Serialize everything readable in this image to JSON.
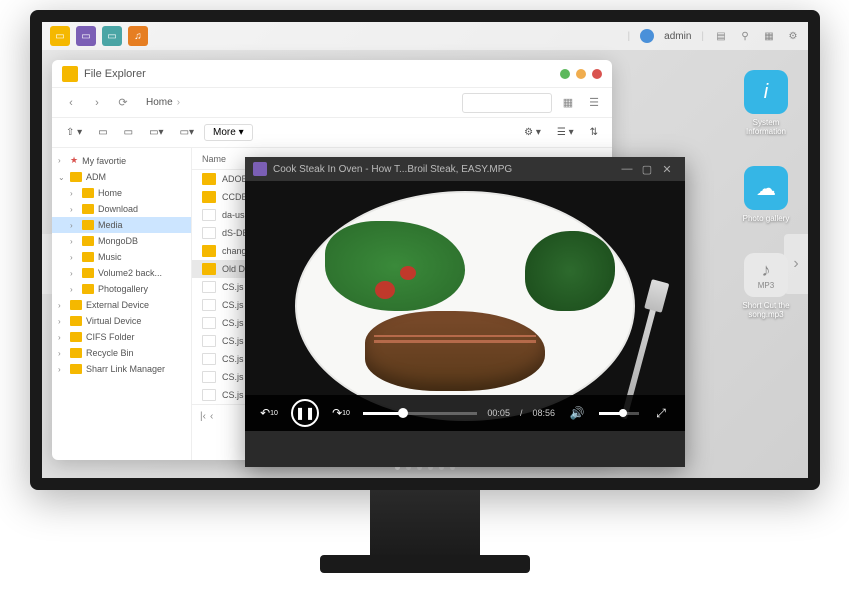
{
  "topbar": {
    "user": "admin"
  },
  "desktop": {
    "icons": [
      {
        "label": "System Information"
      },
      {
        "label": "Photo gallery"
      },
      {
        "label": "MP3",
        "sub": "Short Cut the song.mp3"
      }
    ]
  },
  "explorer": {
    "title": "File Explorer",
    "breadcrumb": "Home",
    "more_label": "More",
    "col_name": "Name",
    "sidebar": [
      {
        "label": "My favortie",
        "type": "fav",
        "expand": "›"
      },
      {
        "label": "ADM",
        "type": "folder",
        "expand": "⌄"
      },
      {
        "label": "Home",
        "type": "sub",
        "expand": "›"
      },
      {
        "label": "Download",
        "type": "sub",
        "expand": "›"
      },
      {
        "label": "Media",
        "type": "sub",
        "selected": true,
        "expand": "›"
      },
      {
        "label": "MongoDB",
        "type": "sub",
        "expand": "›"
      },
      {
        "label": "Music",
        "type": "sub",
        "expand": "›"
      },
      {
        "label": "Volume2 back...",
        "type": "sub",
        "selected2": true,
        "expand": "›"
      },
      {
        "label": "Photogallery",
        "type": "sub",
        "expand": "›"
      },
      {
        "label": "External Device",
        "type": "folder",
        "expand": "›"
      },
      {
        "label": "Virtual Device",
        "type": "folder",
        "expand": "›"
      },
      {
        "label": "CIFS Folder",
        "type": "folder",
        "expand": "›"
      },
      {
        "label": "Recycle Bin",
        "type": "folder",
        "expand": "›"
      },
      {
        "label": "Sharr Link Manager",
        "type": "folder",
        "expand": "›"
      }
    ],
    "files": [
      {
        "name": "ADOBIKD",
        "icon": "folder"
      },
      {
        "name": "CCDES26",
        "icon": "folder"
      },
      {
        "name": "da-us.js",
        "icon": "js"
      },
      {
        "name": "dS-DE.js",
        "icon": "js"
      },
      {
        "name": "change fo",
        "icon": "folder"
      },
      {
        "name": "Old Data",
        "icon": "folder",
        "selected": true
      },
      {
        "name": "CS.js",
        "icon": "js"
      },
      {
        "name": "CS.js",
        "icon": "js"
      },
      {
        "name": "CS.js",
        "icon": "js"
      },
      {
        "name": "CS.js",
        "icon": "js"
      },
      {
        "name": "CS.js",
        "icon": "js"
      },
      {
        "name": "CS.js",
        "icon": "js"
      },
      {
        "name": "CS.js",
        "icon": "js"
      }
    ]
  },
  "player": {
    "title": "Cook Steak In Oven - How T...Broil Steak, EASY.MPG",
    "time_current": "00:05",
    "time_total": "08:56",
    "skip_back": "10",
    "skip_fwd": "10"
  }
}
